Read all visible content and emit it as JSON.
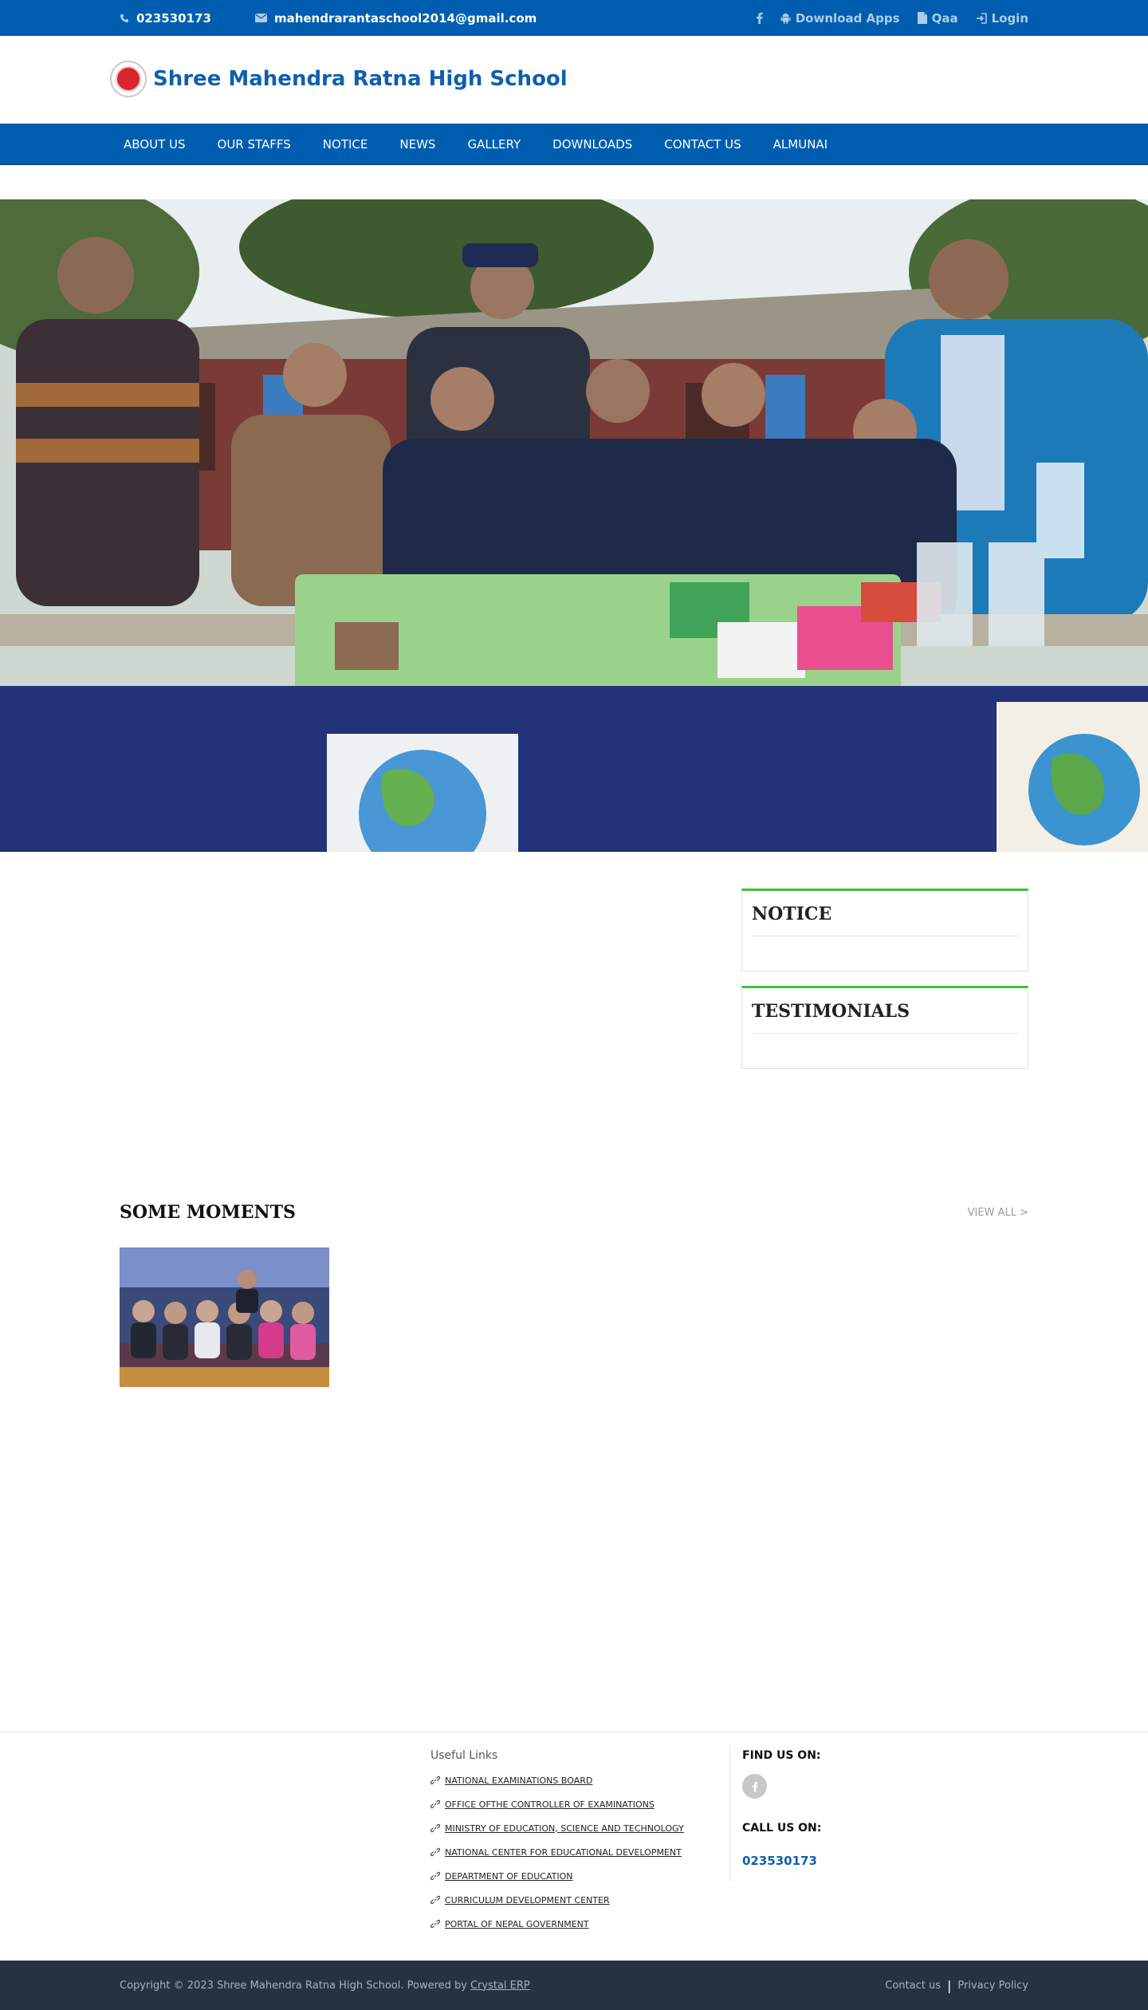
{
  "topbar": {
    "phone": "023530173",
    "email": "mahendrarantaschool2014@gmail.com",
    "download_apps": "Download Apps",
    "qaa": "Qaa",
    "login": "Login",
    "icons": [
      "phone-icon",
      "envelope-icon",
      "facebook-icon",
      "android-icon",
      "file-icon",
      "login-icon"
    ]
  },
  "brand": {
    "name": "Shree Mahendra Ratna High School"
  },
  "nav": {
    "items": [
      "ABOUT US",
      "OUR STAFFS",
      "NOTICE",
      "NEWS",
      "GALLERY",
      "DOWNLOADS",
      "CONTACT US",
      "ALMUNAI"
    ]
  },
  "widgets": {
    "notice_title": "NOTICE",
    "testimonials_title": "TESTIMONIALS"
  },
  "moments": {
    "title": "SOME MOMENTS",
    "view_all": "VIEW ALL >"
  },
  "footer": {
    "useful_links_title": "Useful Links",
    "useful_links": [
      "NATIONAL EXAMINATIONS BOARD",
      "OFFICE OFTHE CONTROLLER OF EXAMINATIONS",
      "MINISTRY OF EDUCATION, SCIENCE AND TECHNOLOGY",
      "NATIONAL CENTER FOR EDUCATIONAL DEVELOPMENT",
      "DEPARTMENT OF EDUCATION",
      "CURRICULUM DEVELOPMENT CENTER",
      "PORTAL OF NEPAL GOVERNMENT"
    ],
    "find_us": "FIND US ON:",
    "call_us": "CALL US ON:",
    "phone": "023530173"
  },
  "bottom": {
    "copyright": "Copyright © 2023 Shree Mahendra Ratna High School. Powered by",
    "powered_by": "Crystal ERP",
    "contact": "Contact us",
    "privacy": "Privacy Policy"
  },
  "colors": {
    "primary": "#005eb0",
    "accent_green": "#3fbf3a",
    "footer_dark": "#253341",
    "link_blue": "#0f5fae"
  }
}
